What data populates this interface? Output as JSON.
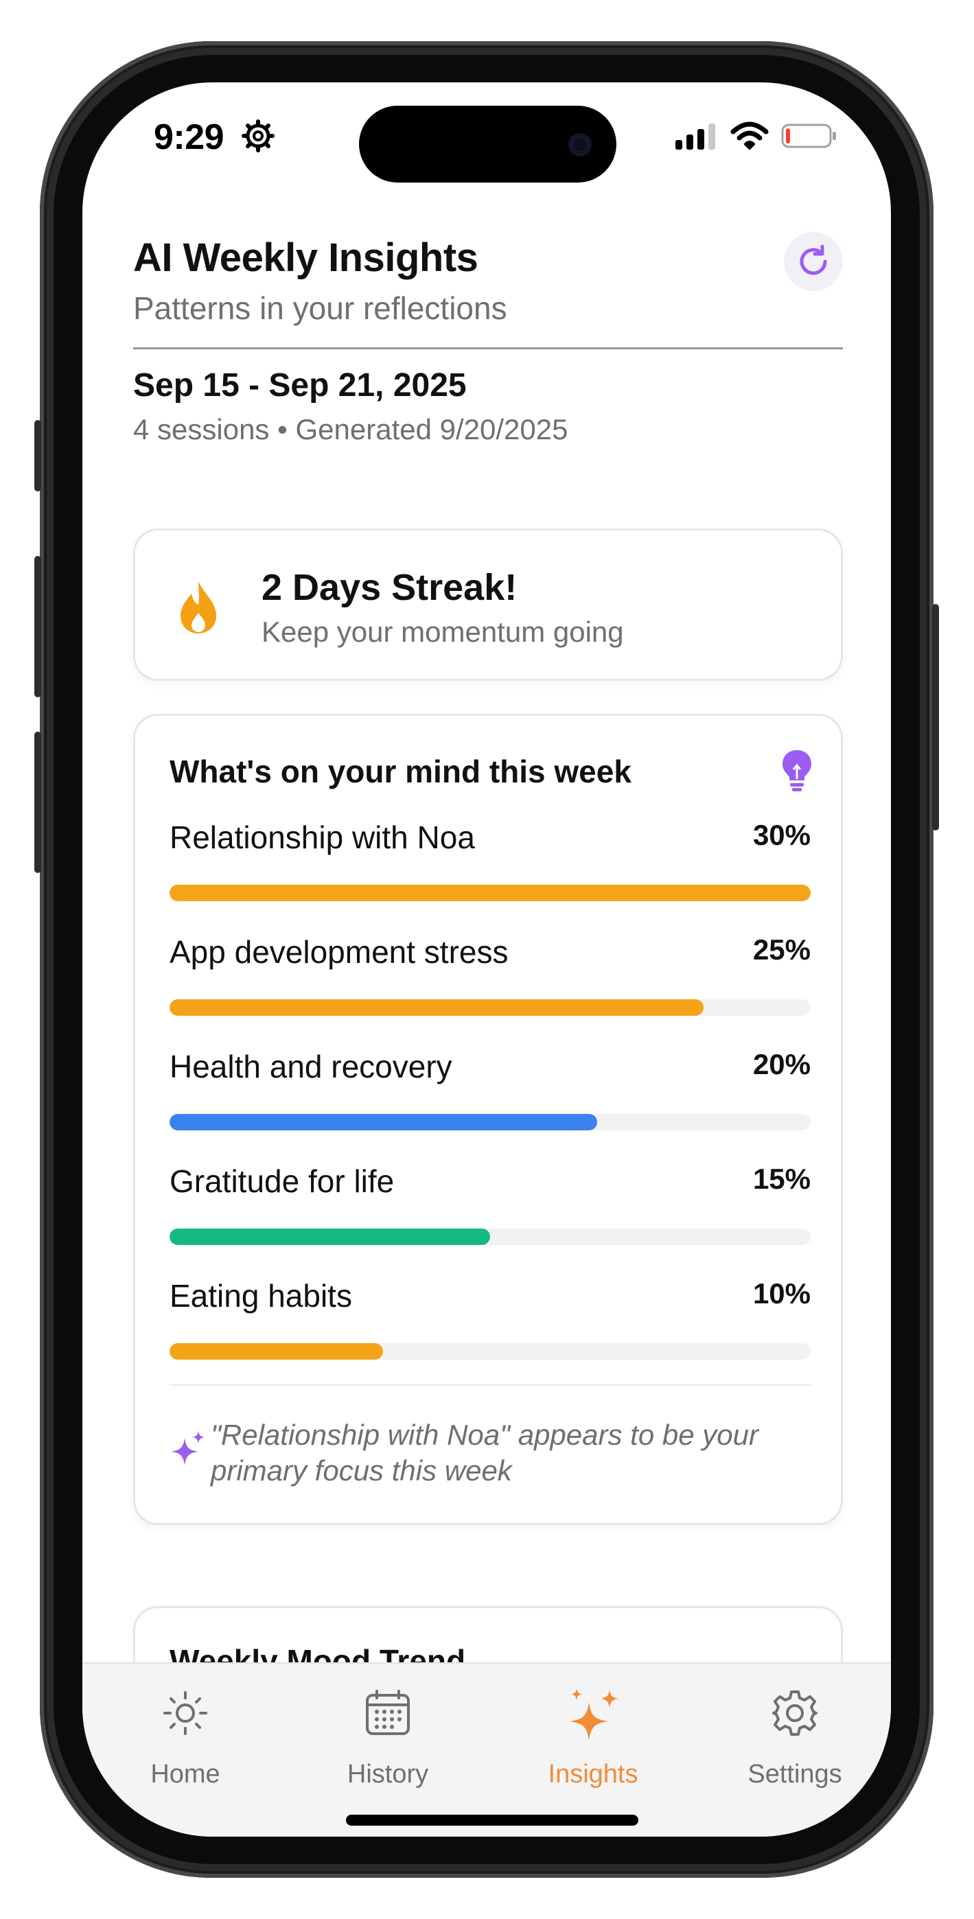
{
  "status_bar": {
    "time": "9:29"
  },
  "header": {
    "title": "AI Weekly Insights",
    "subtitle": "Patterns in your reflections",
    "date_range": "Sep 15 - Sep 21, 2025",
    "meta": "4 sessions • Generated 9/20/2025"
  },
  "streak": {
    "title": "2 Days Streak!",
    "subtitle": "Keep your momentum going"
  },
  "mind": {
    "title": "What's on your mind this week",
    "topics": [
      {
        "label": "Relationship with Noa",
        "percent_label": "30%",
        "fill": 1.0,
        "color": "#f4a418"
      },
      {
        "label": "App development stress",
        "percent_label": "25%",
        "fill": 0.833,
        "color": "#f4a418"
      },
      {
        "label": "Health and recovery",
        "percent_label": "20%",
        "fill": 0.667,
        "color": "#3b82f0"
      },
      {
        "label": "Gratitude for life",
        "percent_label": "15%",
        "fill": 0.5,
        "color": "#16b981"
      },
      {
        "label": "Eating habits",
        "percent_label": "10%",
        "fill": 0.333,
        "color": "#f4a418"
      }
    ],
    "note": "\"Relationship with Noa\" appears to be your primary focus this week"
  },
  "mood": {
    "title": "Weekly Mood Trend"
  },
  "tabs": [
    {
      "label": "Home",
      "icon": "sun-icon"
    },
    {
      "label": "History",
      "icon": "calendar-icon"
    },
    {
      "label": "Insights",
      "icon": "sparkles-icon",
      "active": true
    },
    {
      "label": "Settings",
      "icon": "gear-icon"
    }
  ],
  "colors": {
    "accent": "#f28c38",
    "purple": "#9b5cf0",
    "streak": "#f5a012"
  }
}
